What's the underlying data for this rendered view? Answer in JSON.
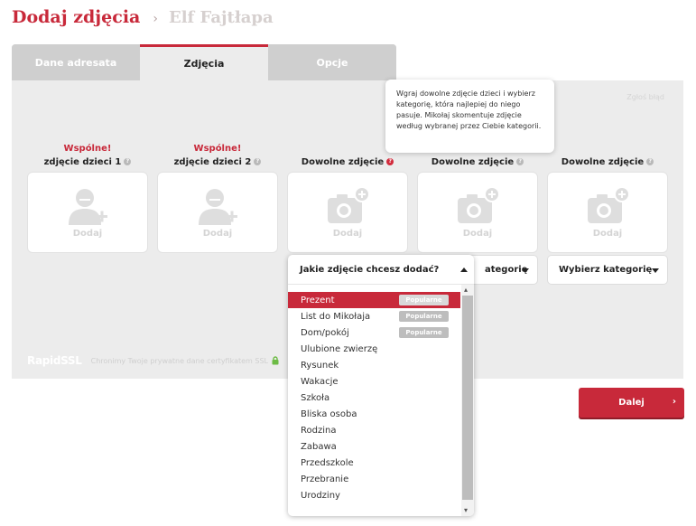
{
  "header": {
    "title": "Dodaj zdjęcia",
    "separator": "›",
    "recipient": "Elf Fajtłapa"
  },
  "tabs": [
    {
      "label": "Dane adresata"
    },
    {
      "label": "Zdjęcia"
    },
    {
      "label": "Opcje"
    }
  ],
  "report_link": "Zgłoś błąd",
  "tooltip": {
    "text": "Wgraj dowolne zdjęcie dzieci i wybierz kategorię, która najlepiej do niego pasuje. Mikołaj skomentuje zdjęcie według wybranej przez Ciebie kategorii."
  },
  "slots": [
    {
      "common": "Wspólne!",
      "label": "zdjęcie dzieci 1",
      "add": "Dodaj",
      "help": "?"
    },
    {
      "common": "Wspólne!",
      "label": "zdjęcie dzieci 2",
      "add": "Dodaj",
      "help": "?"
    },
    {
      "common": "",
      "label": "Dowolne zdjęcie",
      "add": "Dodaj",
      "help": "?"
    },
    {
      "common": "",
      "label": "Dowolne zdjęcie",
      "add": "Dodaj",
      "help": "?"
    },
    {
      "common": "",
      "label": "Dowolne zdjęcie",
      "add": "Dodaj",
      "help": "?"
    }
  ],
  "category_selects": [
    {
      "value": "ategorię"
    },
    {
      "value": "Wybierz kategorię"
    }
  ],
  "dropdown": {
    "question": "Jakie zdjęcie chcesz dodać?",
    "items": [
      {
        "label": "Prezent",
        "badge": "Popularne"
      },
      {
        "label": "List do Mikołaja",
        "badge": "Popularne"
      },
      {
        "label": "Dom/pokój",
        "badge": "Popularne"
      },
      {
        "label": "Ulubione zwierzę",
        "badge": ""
      },
      {
        "label": "Rysunek",
        "badge": ""
      },
      {
        "label": "Wakacje",
        "badge": ""
      },
      {
        "label": "Szkoła",
        "badge": ""
      },
      {
        "label": "Bliska osoba",
        "badge": ""
      },
      {
        "label": "Rodzina",
        "badge": ""
      },
      {
        "label": "Zabawa",
        "badge": ""
      },
      {
        "label": "Przedszkole",
        "badge": ""
      },
      {
        "label": "Przebranie",
        "badge": ""
      },
      {
        "label": "Urodziny",
        "badge": ""
      }
    ]
  },
  "ssl": {
    "brand": "RapidSSL",
    "note": "Chronimy Twoje prywatne dane certyfikatem SSL"
  },
  "next_button": {
    "label": "Dalej",
    "chevron": "›"
  },
  "colors": {
    "accent": "#c8293a",
    "panel": "#ececec",
    "lock": "#6dbb45"
  }
}
